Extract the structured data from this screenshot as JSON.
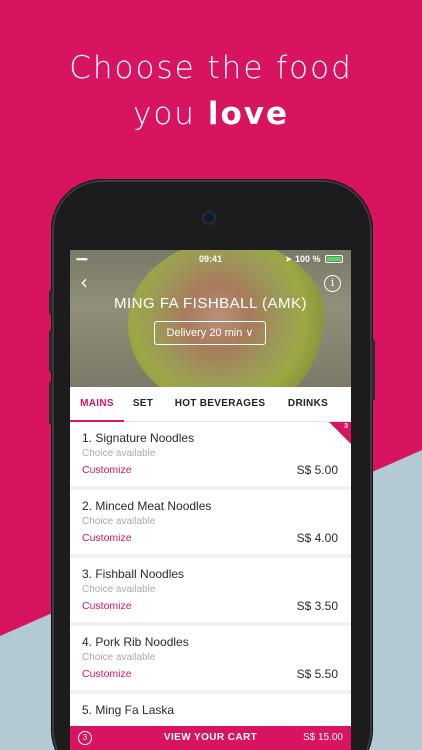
{
  "promo": {
    "line1": "Choose the food",
    "line2_prefix": "you ",
    "line2_bold": "love"
  },
  "status_bar": {
    "time": "09:41",
    "battery": "100 %"
  },
  "restaurant": {
    "name": "MING FA FISHBALL (AMK)",
    "delivery_label": "Delivery 20 min ∨"
  },
  "tabs": [
    {
      "label": "MAINS",
      "active": true
    },
    {
      "label": "SET",
      "active": false
    },
    {
      "label": "HOT BEVERAGES",
      "active": false
    },
    {
      "label": "DRINKS",
      "active": false
    }
  ],
  "list_badge": "3",
  "menu_items": [
    {
      "name": "1. Signature Noodles",
      "sub": "Choice available",
      "customize": "Customize",
      "price": "S$ 5.00"
    },
    {
      "name": "2. Minced Meat Noodles",
      "sub": "Choice available",
      "customize": "Customize",
      "price": "S$ 4.00"
    },
    {
      "name": "3. Fishball Noodles",
      "sub": "Choice available",
      "customize": "Customize",
      "price": "S$ 3.50"
    },
    {
      "name": "4. Pork Rib Noodles",
      "sub": "Choice available",
      "customize": "Customize",
      "price": "S$ 5.50"
    },
    {
      "name": "5. Ming Fa Laska",
      "sub": "",
      "customize": "",
      "price": ""
    }
  ],
  "cart": {
    "count": "3",
    "label": "VIEW YOUR CART",
    "total": "S$ 15.00"
  },
  "colors": {
    "brand": "#d8135f",
    "band": "#b3c9d3"
  }
}
